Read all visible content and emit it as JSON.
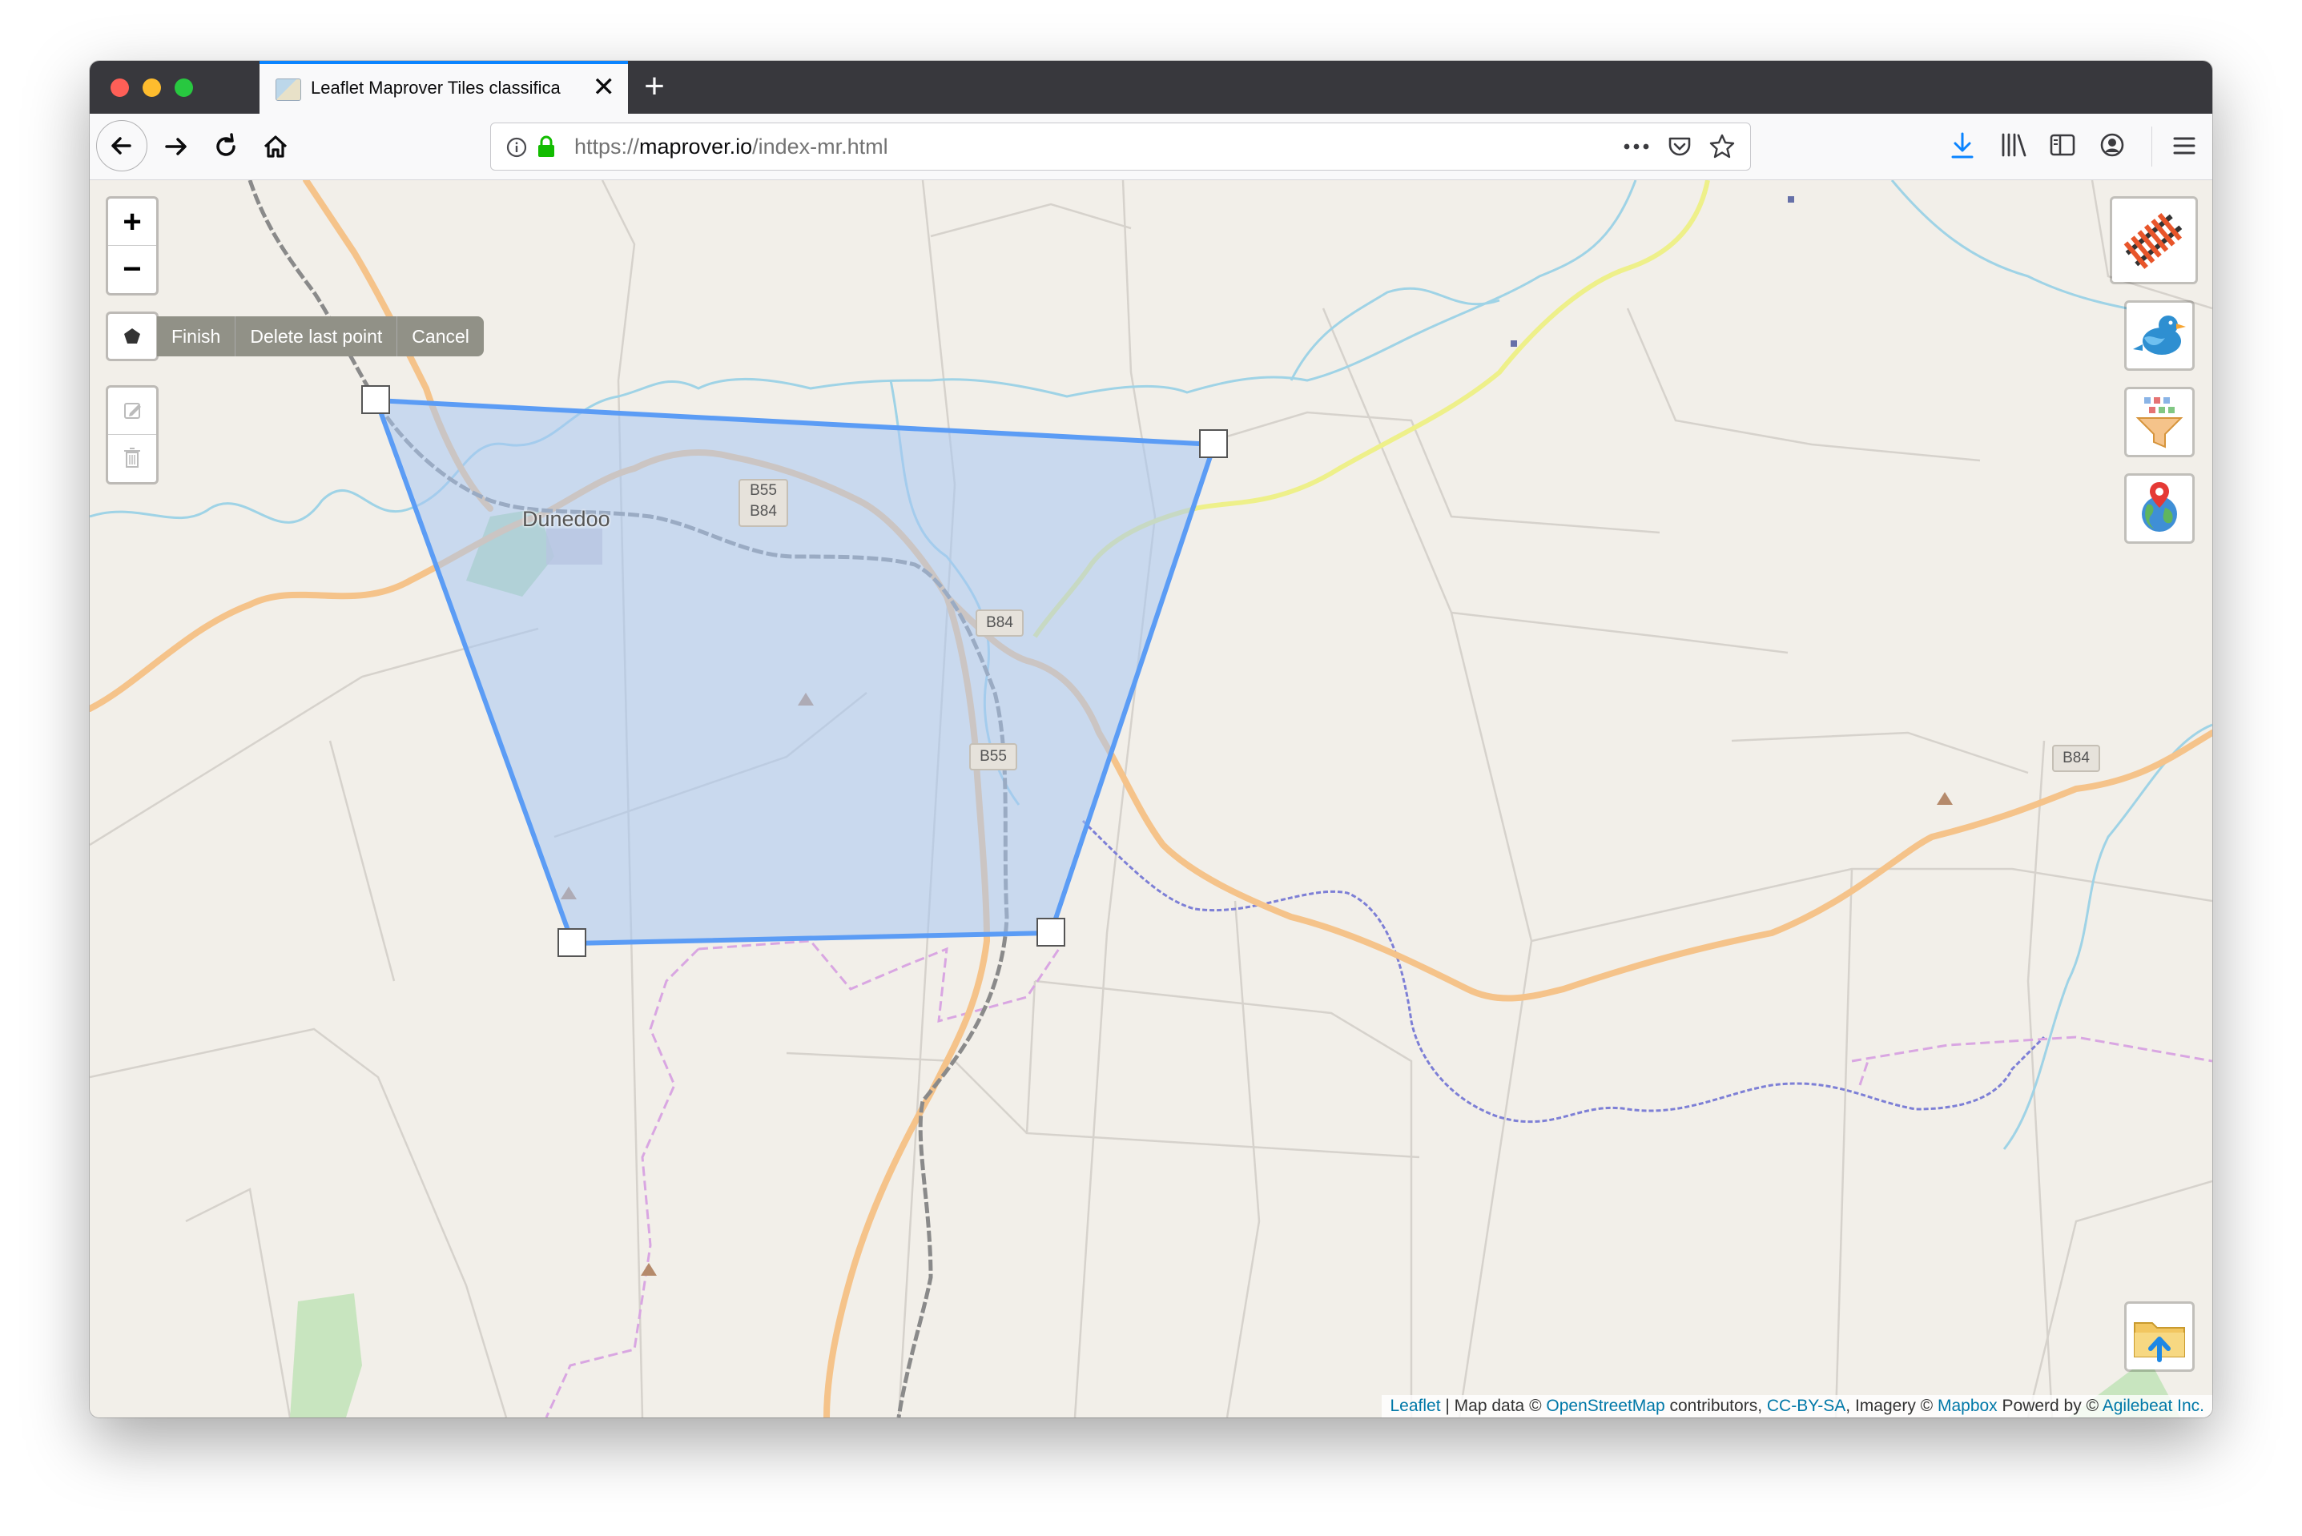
{
  "browser": {
    "tab_title": "Leaflet Maprover Tiles classifica",
    "tab_close": "✕",
    "new_tab": "+",
    "url_scheme": "https://",
    "url_host": "maprover.io",
    "url_path": "/index-mr.html"
  },
  "map": {
    "zoom_in_label": "+",
    "zoom_out_label": "−",
    "draw_actions": {
      "finish": "Finish",
      "delete_last": "Delete last point",
      "cancel": "Cancel"
    },
    "place_label": "Dunedoo",
    "road_shields": {
      "b55_b84_top": "B55",
      "b55_b84_bottom": "B84",
      "b84_center": "B84",
      "b55_center": "B55",
      "b84_east": "B84"
    },
    "side_controls": [
      "railway-tiles-icon",
      "twitter-bird-icon",
      "data-funnel-icon",
      "globe-pin-icon"
    ],
    "upload_control": "folder-upload-icon"
  },
  "attribution": {
    "leaflet": "Leaflet",
    "sep1": " | Map data © ",
    "osm": "OpenStreetMap",
    "contributors": " contributors, ",
    "ccbysa": "CC-BY-SA",
    "imagery": ", Imagery © ",
    "mapbox": "Mapbox",
    "powered": " Powerd by © ",
    "agilebeat": "Agilebeat Inc."
  },
  "colors": {
    "polygon_stroke": "#5b9cf5",
    "polygon_fill": "#a7c6f2",
    "road_orange": "#f5c38a",
    "river_blue": "#9fd3e6",
    "railway": "#8a8a8a",
    "boundary": "#d9a6e2",
    "highway_yellow": "#eef08a"
  }
}
